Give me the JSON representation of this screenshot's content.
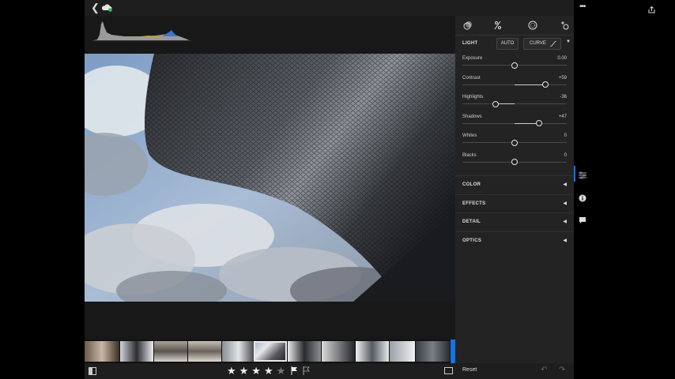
{
  "toolbar": {
    "back_icon": "chevron-left-icon",
    "cloud_icon": "cloud-sync-icon",
    "share_icon": "share-icon",
    "more_label": "•••"
  },
  "panel": {
    "tabs": [
      "presets-icon",
      "edit-sliders-icon",
      "selective-icon",
      "healing-icon"
    ],
    "light": {
      "title": "LIGHT",
      "auto_label": "AUTO",
      "curve_label": "CURVE",
      "sliders": [
        {
          "label": "Exposure",
          "value": "0.00",
          "min": -5,
          "max": 5,
          "num": 0
        },
        {
          "label": "Contrast",
          "value": "+59",
          "min": -100,
          "max": 100,
          "num": 59
        },
        {
          "label": "Highlights",
          "value": "-36",
          "min": -100,
          "max": 100,
          "num": -36
        },
        {
          "label": "Shadows",
          "value": "+47",
          "min": -100,
          "max": 100,
          "num": 47
        },
        {
          "label": "Whites",
          "value": "0",
          "min": -100,
          "max": 100,
          "num": 0
        },
        {
          "label": "Blacks",
          "value": "0",
          "min": -100,
          "max": 100,
          "num": 0
        }
      ]
    },
    "sections": [
      "COLOR",
      "EFFECTS",
      "DETAIL",
      "OPTICS"
    ]
  },
  "rail": {
    "icons": [
      "edit-icon",
      "info-icon",
      "comment-icon"
    ]
  },
  "bottom": {
    "rating": 4,
    "rating_max": 5,
    "stars_on": "★★★★",
    "stars_off": "★",
    "reset_label": "Reset"
  },
  "filmstrip": {
    "count": 11,
    "selected_index": 5
  },
  "colors": {
    "accent": "#1473e6",
    "panel_bg": "#232323",
    "app_bg": "#181818"
  }
}
